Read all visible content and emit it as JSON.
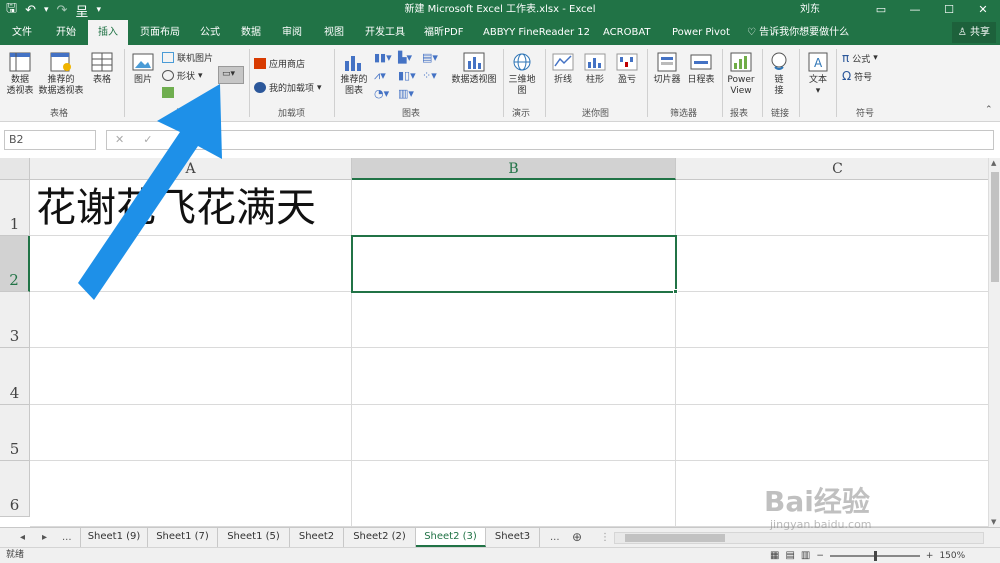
{
  "app": {
    "title": "新建 Microsoft Excel 工作表.xlsx  -  Excel",
    "user": "刘东",
    "accent_color": "#217346",
    "window_controls": [
      "▭",
      "—",
      "☐",
      "✕"
    ]
  },
  "qat": {
    "save_icon": "🖫",
    "undo_icon": "↶",
    "undo_dropdown": "▾",
    "redo_icon": "↷",
    "custom_icon": "呈",
    "more_icon": "▾"
  },
  "tabs": [
    "文件",
    "开始",
    "插入",
    "页面布局",
    "公式",
    "数据",
    "审阅",
    "视图",
    "开发工具",
    "福昕PDF",
    "ABBYY FineReader 12",
    "ACROBAT",
    "Power Pivot"
  ],
  "active_tab": "插入",
  "tell_me": "告诉我你想要做什么",
  "share": "共享",
  "ribbon": {
    "groups": [
      {
        "label": "表格",
        "items": [
          "数据\n透视表",
          "推荐的\n数据透视表",
          "表格"
        ]
      },
      {
        "label": "插图",
        "items": [
          "图片",
          "联机图片",
          "形状"
        ]
      },
      {
        "label": "加载项",
        "items": [
          "应用商店",
          "我的加载项"
        ]
      },
      {
        "label": "图表",
        "items": [
          "推荐的\n图表",
          "数据透视图"
        ]
      },
      {
        "label": "演示",
        "items": [
          "三维地\n图"
        ]
      },
      {
        "label": "迷你图",
        "items": [
          "折线",
          "柱形",
          "盈亏"
        ]
      },
      {
        "label": "筛选器",
        "items": [
          "切片器",
          "日程表"
        ]
      },
      {
        "label": "报表",
        "items": [
          "Power\nView"
        ]
      },
      {
        "label": "链接",
        "items": [
          "链\n接"
        ]
      },
      {
        "label": "",
        "items": [
          "文本"
        ]
      },
      {
        "label": "符号",
        "items": [
          "公式",
          "符号"
        ]
      }
    ]
  },
  "formula_bar": {
    "name_box": "B2",
    "cancel": "✕",
    "enter": "✓",
    "fx": "fx",
    "value": ""
  },
  "grid": {
    "columns": [
      "A",
      "B",
      "C"
    ],
    "selected_column": "B",
    "rows": [
      "1",
      "2",
      "3",
      "4",
      "5",
      "6"
    ],
    "selected_row": "2",
    "cells": {
      "A1": "花谢花飞花满天"
    }
  },
  "sheets": [
    "Sheet1 (9)",
    "Sheet1 (7)",
    "Sheet1 (5)",
    "Sheet2",
    "Sheet2 (2)",
    "Sheet2 (3)",
    "Sheet3"
  ],
  "active_sheet": "Sheet2 (3)",
  "sheet_nav": {
    "prev": "◂",
    "next": "▸",
    "more_left": "...",
    "more_right": "...",
    "add": "⊕"
  },
  "status": {
    "ready": "就绪",
    "zoom": "150%",
    "zoom_out": "−",
    "zoom_in": "+"
  },
  "watermark": {
    "text": "Bai经验",
    "url": "jingyan.baidu.com"
  }
}
